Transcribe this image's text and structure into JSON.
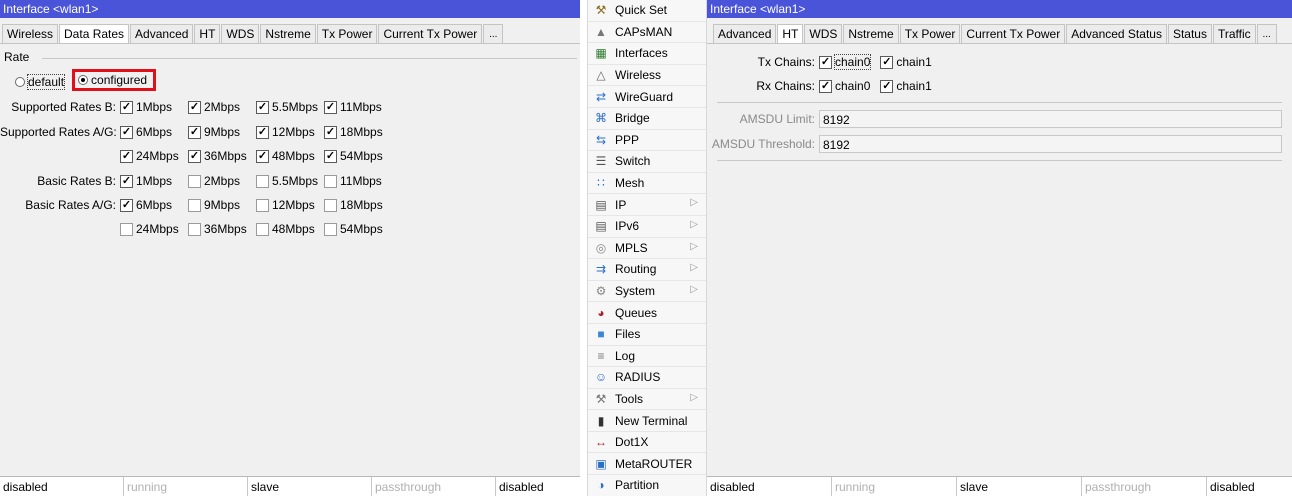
{
  "left": {
    "title": "Interface <wlan1>",
    "tabs": [
      "Wireless",
      "Data Rates",
      "Advanced",
      "HT",
      "WDS",
      "Nstreme",
      "Tx Power",
      "Current Tx Power",
      "..."
    ],
    "active_tab": "Data Rates",
    "rate_group_title": "Rate",
    "rate_options": [
      {
        "label": "default",
        "selected": false
      },
      {
        "label": "configured",
        "selected": true
      }
    ],
    "rows": [
      {
        "label": "Supported Rates B:",
        "items": [
          {
            "label": "1Mbps",
            "checked": true
          },
          {
            "label": "2Mbps",
            "checked": true
          },
          {
            "label": "5.5Mbps",
            "checked": true
          },
          {
            "label": "11Mbps",
            "checked": true
          }
        ]
      },
      {
        "label": "Supported Rates A/G:",
        "items": [
          {
            "label": "6Mbps",
            "checked": true
          },
          {
            "label": "9Mbps",
            "checked": true
          },
          {
            "label": "12Mbps",
            "checked": true
          },
          {
            "label": "18Mbps",
            "checked": true
          }
        ]
      },
      {
        "label": "",
        "items": [
          {
            "label": "24Mbps",
            "checked": true
          },
          {
            "label": "36Mbps",
            "checked": true
          },
          {
            "label": "48Mbps",
            "checked": true
          },
          {
            "label": "54Mbps",
            "checked": true
          }
        ]
      },
      {
        "label": "Basic Rates B:",
        "items": [
          {
            "label": "1Mbps",
            "checked": true
          },
          {
            "label": "2Mbps",
            "checked": false
          },
          {
            "label": "5.5Mbps",
            "checked": false
          },
          {
            "label": "11Mbps",
            "checked": false
          }
        ]
      },
      {
        "label": "Basic Rates A/G:",
        "items": [
          {
            "label": "6Mbps",
            "checked": true
          },
          {
            "label": "9Mbps",
            "checked": false
          },
          {
            "label": "12Mbps",
            "checked": false
          },
          {
            "label": "18Mbps",
            "checked": false
          }
        ]
      },
      {
        "label": "",
        "items": [
          {
            "label": "24Mbps",
            "checked": false
          },
          {
            "label": "36Mbps",
            "checked": false
          },
          {
            "label": "48Mbps",
            "checked": false
          },
          {
            "label": "54Mbps",
            "checked": false
          }
        ]
      }
    ],
    "status": [
      "disabled",
      "running",
      "slave",
      "passthrough",
      "disabled"
    ]
  },
  "menu": {
    "items": [
      {
        "label": "Quick Set",
        "icon": "quick-set-icon",
        "submenu": false
      },
      {
        "label": "CAPsMAN",
        "icon": "capsman-icon",
        "submenu": false
      },
      {
        "label": "Interfaces",
        "icon": "interfaces-icon",
        "submenu": false
      },
      {
        "label": "Wireless",
        "icon": "wireless-icon",
        "submenu": false
      },
      {
        "label": "WireGuard",
        "icon": "wireguard-icon",
        "submenu": false
      },
      {
        "label": "Bridge",
        "icon": "bridge-icon",
        "submenu": false
      },
      {
        "label": "PPP",
        "icon": "ppp-icon",
        "submenu": false
      },
      {
        "label": "Switch",
        "icon": "switch-icon",
        "submenu": false
      },
      {
        "label": "Mesh",
        "icon": "mesh-icon",
        "submenu": false
      },
      {
        "label": "IP",
        "icon": "ip-icon",
        "submenu": true
      },
      {
        "label": "IPv6",
        "icon": "ipv6-icon",
        "submenu": true
      },
      {
        "label": "MPLS",
        "icon": "mpls-icon",
        "submenu": true
      },
      {
        "label": "Routing",
        "icon": "routing-icon",
        "submenu": true
      },
      {
        "label": "System",
        "icon": "system-icon",
        "submenu": true
      },
      {
        "label": "Queues",
        "icon": "queues-icon",
        "submenu": false
      },
      {
        "label": "Files",
        "icon": "files-icon",
        "submenu": false
      },
      {
        "label": "Log",
        "icon": "log-icon",
        "submenu": false
      },
      {
        "label": "RADIUS",
        "icon": "radius-icon",
        "submenu": false
      },
      {
        "label": "Tools",
        "icon": "tools-icon",
        "submenu": true
      },
      {
        "label": "New Terminal",
        "icon": "terminal-icon",
        "submenu": false
      },
      {
        "label": "Dot1X",
        "icon": "dot1x-icon",
        "submenu": false
      },
      {
        "label": "MetaROUTER",
        "icon": "metarouter-icon",
        "submenu": false
      },
      {
        "label": "Partition",
        "icon": "partition-icon",
        "submenu": false
      }
    ]
  },
  "right": {
    "title": "Interface <wlan1>",
    "tabs": [
      "Advanced",
      "HT",
      "WDS",
      "Nstreme",
      "Tx Power",
      "Current Tx Power",
      "Advanced Status",
      "Status",
      "Traffic",
      "..."
    ],
    "active_tab": "HT",
    "tx_chains_label": "Tx Chains:",
    "tx_chains": [
      {
        "label": "chain0",
        "checked": true
      },
      {
        "label": "chain1",
        "checked": true
      }
    ],
    "rx_chains_label": "Rx Chains:",
    "rx_chains": [
      {
        "label": "chain0",
        "checked": true
      },
      {
        "label": "chain1",
        "checked": true
      }
    ],
    "amsdu_limit_label": "AMSDU Limit:",
    "amsdu_limit": "8192",
    "amsdu_threshold_label": "AMSDU Threshold:",
    "amsdu_threshold": "8192",
    "status": [
      "disabled",
      "running",
      "slave",
      "passthrough",
      "disabled"
    ]
  }
}
